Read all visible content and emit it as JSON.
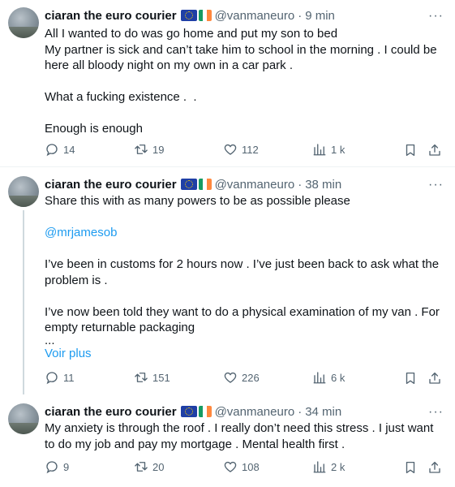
{
  "tweets": [
    {
      "author": "ciaran the euro courier",
      "handle": "@vanmaneuro",
      "dot": "·",
      "time": "9 min",
      "more": "···",
      "lines": [
        "All I wanted to do was go home and put my son to bed",
        "My partner is sick and can’t take him to school in the morning . I could be here all bloody night on my own in a car park .",
        "",
        "What a fucking existence .  .",
        "",
        "Enough is enough"
      ],
      "replies": "14",
      "retweets": "19",
      "likes": "112",
      "views": "1 k"
    },
    {
      "author": "ciaran the euro courier",
      "handle": "@vanmaneuro",
      "dot": "·",
      "time": "38 min",
      "more": "···",
      "line1": "Share this with as many powers to be as possible please",
      "mention": "@mrjamesob",
      "para2": "I’ve been in customs for 2 hours now . I’ve just been back to ask what the problem is .",
      "para3": "I’ve now been told they want to do a physical examination of my van . For empty returnable packaging",
      "ellipsis": "...",
      "voir_plus": "Voir plus",
      "replies": "11",
      "retweets": "151",
      "likes": "226",
      "views": "6 k"
    },
    {
      "author": "ciaran the euro courier",
      "handle": "@vanmaneuro",
      "dot": "·",
      "time": "34 min",
      "more": "···",
      "text": "My anxiety is through the roof . I really don’t need this stress . I just want to do my job and pay my mortgage . Mental health first .",
      "replies": "9",
      "retweets": "20",
      "likes": "108",
      "views": "2 k"
    }
  ],
  "colors": {
    "text": "#0f1419",
    "muted": "#536471",
    "link": "#1d9bf0",
    "thread_line": "#cfd9de"
  }
}
